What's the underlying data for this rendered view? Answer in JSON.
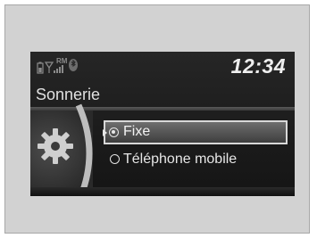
{
  "status_bar": {
    "clock": "12:34",
    "icons": [
      "battery-icon",
      "signal-icon",
      "roam-icon",
      "bluetooth-icon"
    ],
    "roam_text": "RM"
  },
  "screen": {
    "title": "Sonnerie"
  },
  "menu": {
    "items": [
      {
        "label": "Fixe",
        "selected": true,
        "highlighted": true
      },
      {
        "label": "Téléphone mobile",
        "selected": false,
        "highlighted": false
      }
    ]
  },
  "colors": {
    "screen_bg": "#1f1f1f",
    "text": "#efefef",
    "frame_bg": "#d2d2d2"
  }
}
